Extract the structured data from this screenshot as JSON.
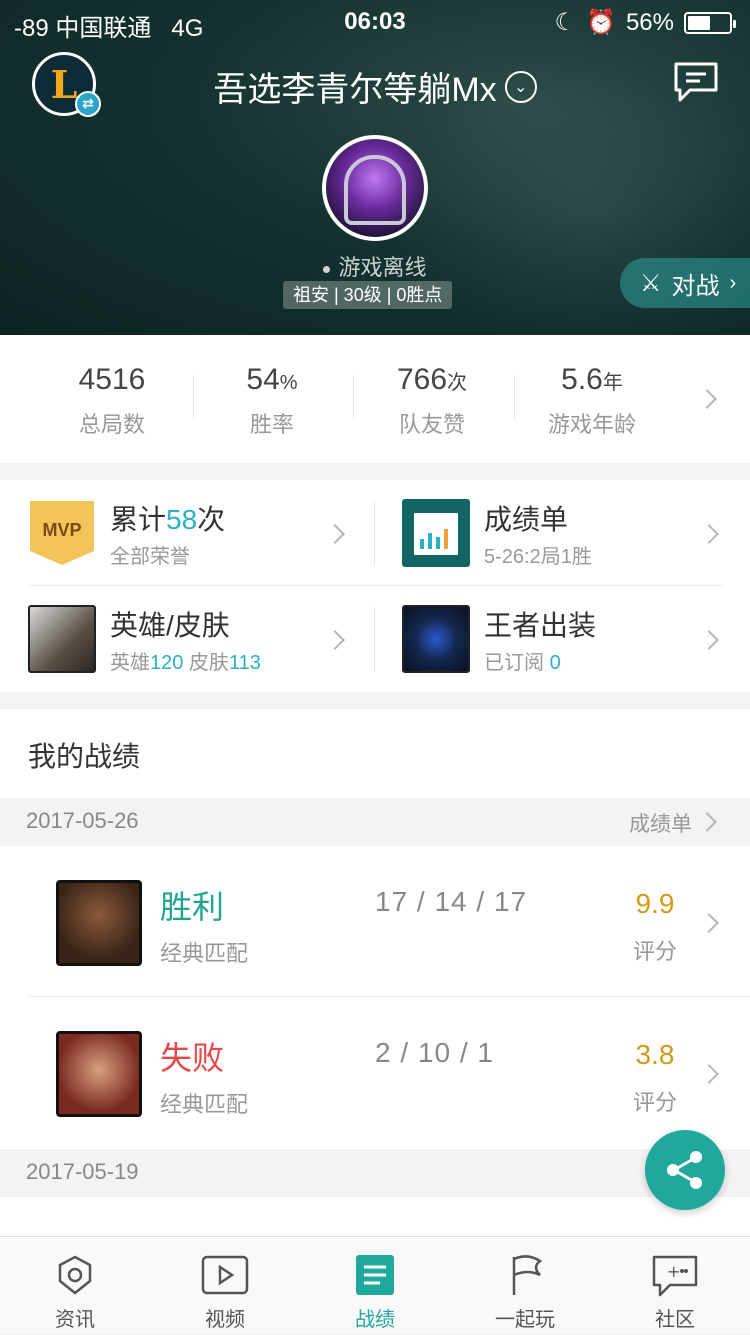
{
  "status_bar": {
    "carrier": "-89 中国联通",
    "network": "4G",
    "time": "06:03",
    "battery": "56%",
    "battery_level": 0.56
  },
  "header": {
    "title": "吾选李青尔等躺Mx",
    "presence": "游戏离线",
    "rank_info": "祖安 | 30级 | 0胜点",
    "battle_button": "对战"
  },
  "stats": [
    {
      "value": "4516",
      "unit": "",
      "label": "总局数"
    },
    {
      "value": "54",
      "unit": "%",
      "label": "胜率"
    },
    {
      "value": "766",
      "unit": "次",
      "label": "队友赞"
    },
    {
      "value": "5.6",
      "unit": "年",
      "label": "游戏年龄"
    }
  ],
  "honors": {
    "mvp": {
      "badge": "MVP",
      "title_pre": "累计",
      "count": "58",
      "title_post": "次",
      "sub": "全部荣誉"
    },
    "report": {
      "title": "成绩单",
      "sub": "5-26:2局1胜"
    },
    "heroes": {
      "title": "英雄/皮肤",
      "hero_label": "英雄",
      "hero_count": "120",
      "skin_label": " 皮肤",
      "skin_count": "113"
    },
    "outfit": {
      "title": "王者出装",
      "sub_label": "已订阅 ",
      "sub_count": "0"
    }
  },
  "records": {
    "title": "我的战绩",
    "report_link": "成绩单",
    "date1": "2017-05-26",
    "date2": "2017-05-19",
    "matches": [
      {
        "result": "胜利",
        "result_color": "#1fa58f",
        "mode": "经典匹配",
        "kda": "17 / 14 / 17",
        "score": "9.9",
        "score_label": "评分"
      },
      {
        "result": "失败",
        "result_color": "#e8474a",
        "mode": "经典匹配",
        "kda": "2 / 10 / 1",
        "score": "3.8",
        "score_label": "评分"
      }
    ]
  },
  "tabs": [
    {
      "label": "资讯",
      "icon": "news-icon"
    },
    {
      "label": "视频",
      "icon": "video-icon"
    },
    {
      "label": "战绩",
      "icon": "record-icon"
    },
    {
      "label": "一起玩",
      "icon": "flag-icon"
    },
    {
      "label": "社区",
      "icon": "community-icon"
    }
  ],
  "colors": {
    "accent": "#20a89c",
    "header_bg": "#143230",
    "score": "#d49a17"
  }
}
